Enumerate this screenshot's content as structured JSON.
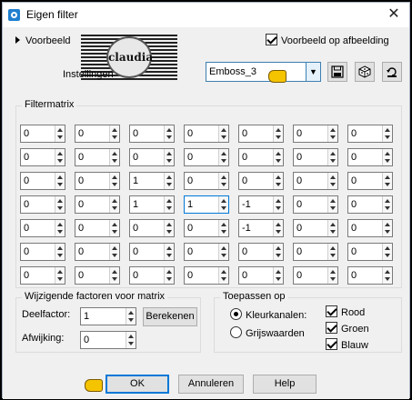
{
  "window": {
    "title": "Eigen filter",
    "close_glyph": "✕"
  },
  "header": {
    "preview_label": "Voorbeeld",
    "preview_on_image_label": "Voorbeeld op afbeelding",
    "preview_on_image_checked": true,
    "logo_text": "claudia",
    "settings_label": "Instellingen",
    "preset_value": "Emboss_3"
  },
  "matrix": {
    "group_title": "Filtermatrix",
    "rows": [
      [
        "0",
        "0",
        "0",
        "0",
        "0",
        "0",
        "0"
      ],
      [
        "0",
        "0",
        "0",
        "0",
        "0",
        "0",
        "0"
      ],
      [
        "0",
        "0",
        "1",
        "0",
        "0",
        "0",
        "0"
      ],
      [
        "0",
        "0",
        "1",
        "1",
        "-1",
        "0",
        "0"
      ],
      [
        "0",
        "0",
        "0",
        "0",
        "-1",
        "0",
        "0"
      ],
      [
        "0",
        "0",
        "0",
        "0",
        "0",
        "0",
        "0"
      ],
      [
        "0",
        "0",
        "0",
        "0",
        "0",
        "0",
        "0"
      ]
    ]
  },
  "factors": {
    "group_title": "Wijzigende factoren voor matrix",
    "divisor_label": "Deelfactor:",
    "divisor_value": "1",
    "calculate_label": "Berekenen",
    "bias_label": "Afwijking:",
    "bias_value": "0"
  },
  "apply": {
    "group_title": "Toepassen op",
    "color_channels_label": "Kleurkanalen:",
    "grayscale_label": "Grijswaarden",
    "selected": "color_channels",
    "red_label": "Rood",
    "green_label": "Groen",
    "blue_label": "Blauw"
  },
  "footer": {
    "ok_label": "OK",
    "cancel_label": "Annuleren",
    "help_label": "Help"
  },
  "colors": {
    "accent": "#0078d7",
    "pointer": "#f5c400"
  }
}
